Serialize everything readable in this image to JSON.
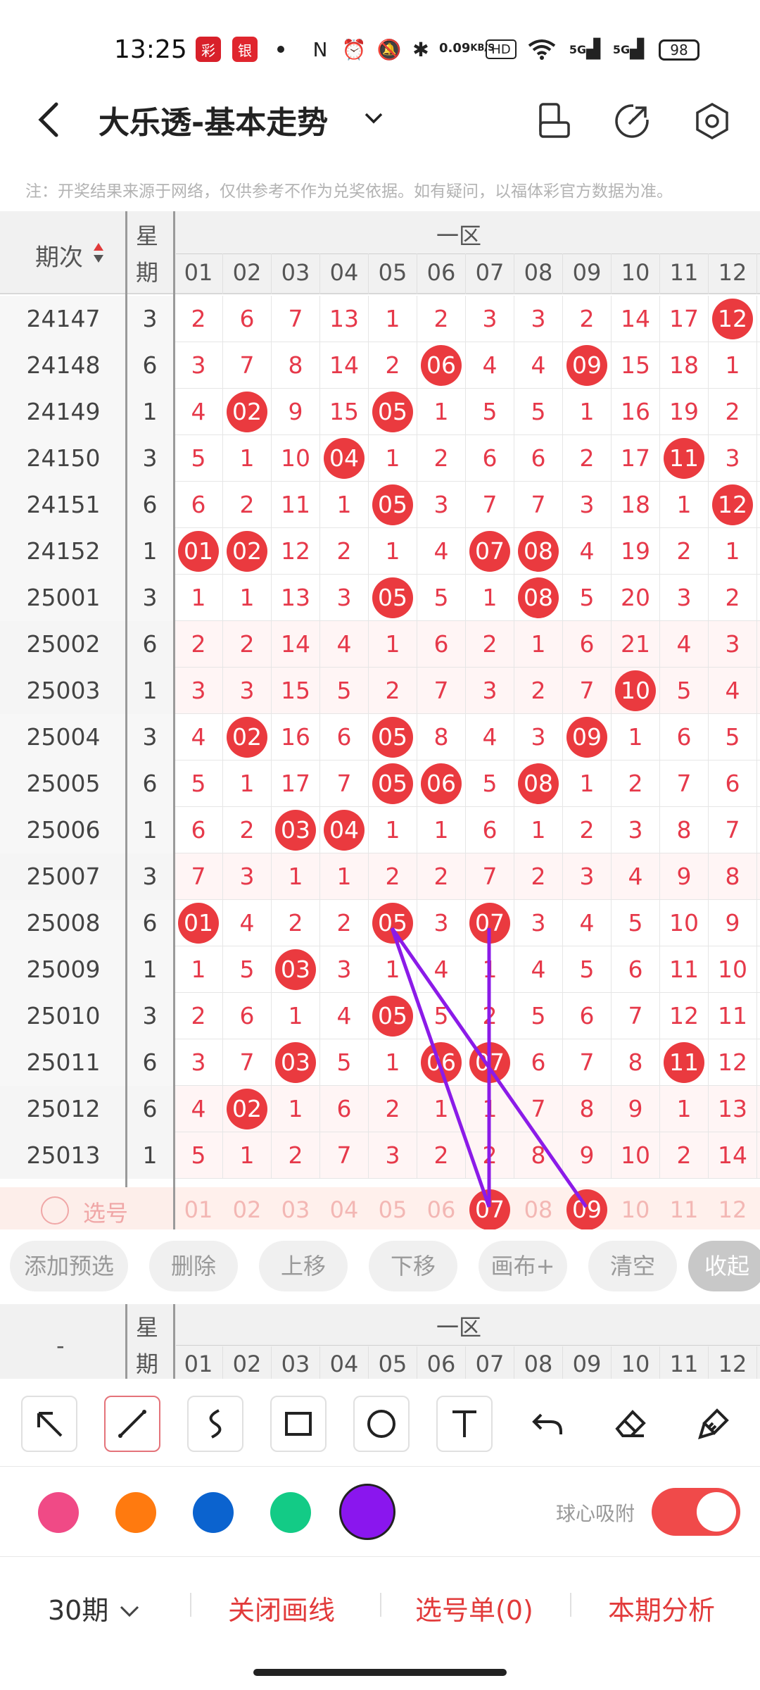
{
  "status": {
    "time": "13:25",
    "net_speed_value": "0.09",
    "net_speed_unit": "KB/S",
    "hd": "HD",
    "signal1": "5G",
    "signal2": "5G",
    "battery": "98"
  },
  "header": {
    "title": "大乐透-基本走势"
  },
  "notice": "注：开奖结果来源于网络，仅供参考不作为兑奖依据。如有疑问，以福体彩官方数据为准。",
  "table": {
    "issue_label": "期次",
    "week_label1": "星",
    "week_label2": "期",
    "zone_label": "一区",
    "columns": [
      "01",
      "02",
      "03",
      "04",
      "05",
      "06",
      "07",
      "08",
      "09",
      "10",
      "11",
      "12"
    ],
    "rows": [
      {
        "issue": "24147",
        "week": "3",
        "cells": [
          "2",
          "6",
          "7",
          "13",
          "1",
          "2",
          "3",
          "3",
          "2",
          "14",
          "17",
          "12"
        ],
        "hits": [
          11
        ]
      },
      {
        "issue": "24148",
        "week": "6",
        "cells": [
          "3",
          "7",
          "8",
          "14",
          "2",
          "06",
          "4",
          "4",
          "09",
          "15",
          "18",
          "1"
        ],
        "hits": [
          5,
          8
        ]
      },
      {
        "issue": "24149",
        "week": "1",
        "cells": [
          "4",
          "02",
          "9",
          "15",
          "05",
          "1",
          "5",
          "5",
          "1",
          "16",
          "19",
          "2"
        ],
        "hits": [
          1,
          4
        ]
      },
      {
        "issue": "24150",
        "week": "3",
        "cells": [
          "5",
          "1",
          "10",
          "04",
          "1",
          "2",
          "6",
          "6",
          "2",
          "17",
          "11",
          "3"
        ],
        "hits": [
          3,
          10
        ]
      },
      {
        "issue": "24151",
        "week": "6",
        "cells": [
          "6",
          "2",
          "11",
          "1",
          "05",
          "3",
          "7",
          "7",
          "3",
          "18",
          "1",
          "12"
        ],
        "hits": [
          4,
          11
        ]
      },
      {
        "issue": "24152",
        "week": "1",
        "cells": [
          "01",
          "02",
          "12",
          "2",
          "1",
          "4",
          "07",
          "08",
          "4",
          "19",
          "2",
          "1"
        ],
        "hits": [
          0,
          1,
          6,
          7
        ]
      },
      {
        "issue": "25001",
        "week": "3",
        "cells": [
          "1",
          "1",
          "13",
          "3",
          "05",
          "5",
          "1",
          "08",
          "5",
          "20",
          "3",
          "2"
        ],
        "hits": [
          4,
          7
        ]
      },
      {
        "issue": "25002",
        "week": "6",
        "cells": [
          "2",
          "2",
          "14",
          "4",
          "1",
          "6",
          "2",
          "1",
          "6",
          "21",
          "4",
          "3"
        ],
        "hits": []
      },
      {
        "issue": "25003",
        "week": "1",
        "cells": [
          "3",
          "3",
          "15",
          "5",
          "2",
          "7",
          "3",
          "2",
          "7",
          "10",
          "5",
          "4"
        ],
        "hits": [
          9
        ]
      },
      {
        "issue": "25004",
        "week": "3",
        "cells": [
          "4",
          "02",
          "16",
          "6",
          "05",
          "8",
          "4",
          "3",
          "09",
          "1",
          "6",
          "5"
        ],
        "hits": [
          1,
          4,
          8
        ]
      },
      {
        "issue": "25005",
        "week": "6",
        "cells": [
          "5",
          "1",
          "17",
          "7",
          "05",
          "06",
          "5",
          "08",
          "1",
          "2",
          "7",
          "6"
        ],
        "hits": [
          4,
          5,
          7
        ]
      },
      {
        "issue": "25006",
        "week": "1",
        "cells": [
          "6",
          "2",
          "03",
          "04",
          "1",
          "1",
          "6",
          "1",
          "2",
          "3",
          "8",
          "7"
        ],
        "hits": [
          2,
          3
        ]
      },
      {
        "issue": "25007",
        "week": "3",
        "cells": [
          "7",
          "3",
          "1",
          "1",
          "2",
          "2",
          "7",
          "2",
          "3",
          "4",
          "9",
          "8"
        ],
        "hits": []
      },
      {
        "issue": "25008",
        "week": "6",
        "cells": [
          "01",
          "4",
          "2",
          "2",
          "05",
          "3",
          "07",
          "3",
          "4",
          "5",
          "10",
          "9"
        ],
        "hits": [
          0,
          4,
          6
        ]
      },
      {
        "issue": "25009",
        "week": "1",
        "cells": [
          "1",
          "5",
          "03",
          "3",
          "1",
          "4",
          "1",
          "4",
          "5",
          "6",
          "11",
          "10"
        ],
        "hits": [
          2
        ]
      },
      {
        "issue": "25010",
        "week": "3",
        "cells": [
          "2",
          "6",
          "1",
          "4",
          "05",
          "5",
          "2",
          "5",
          "6",
          "7",
          "12",
          "11"
        ],
        "hits": [
          4
        ]
      },
      {
        "issue": "25011",
        "week": "6",
        "cells": [
          "3",
          "7",
          "03",
          "5",
          "1",
          "06",
          "07",
          "6",
          "7",
          "8",
          "11",
          "12"
        ],
        "hits": [
          2,
          5,
          6,
          10
        ]
      },
      {
        "issue": "25012",
        "week": "6",
        "cells": [
          "4",
          "02",
          "1",
          "6",
          "2",
          "1",
          "1",
          "7",
          "8",
          "9",
          "1",
          "13"
        ],
        "hits": [
          1
        ]
      },
      {
        "issue": "25013",
        "week": "1",
        "cells": [
          "5",
          "1",
          "2",
          "7",
          "3",
          "2",
          "2",
          "8",
          "9",
          "10",
          "2",
          "14"
        ],
        "hits": []
      }
    ],
    "select_label": "选号",
    "selected_balls": [
      6,
      8
    ]
  },
  "actions": [
    "添加预选",
    "删除",
    "上移",
    "下移",
    "画布+",
    "清空",
    "收起"
  ],
  "second_header": {
    "dash": "-",
    "week1": "星",
    "week2": "期",
    "zone": "一区"
  },
  "tools": [
    "arrow-tool",
    "line-tool",
    "curve-tool",
    "rectangle-tool",
    "circle-tool",
    "text-tool",
    "undo-tool",
    "eraser-tool",
    "clear-brush-tool"
  ],
  "colors": {
    "pink": "#f04a86",
    "orange": "#ff7a0f",
    "blue": "#0b63cf",
    "green": "#13cb86",
    "purple": "#8a16ee",
    "accent": "#ea3a3f"
  },
  "snap": {
    "label": "球心吸附",
    "enabled": true
  },
  "bottom_bar": {
    "periods": "30期",
    "close_lines": "关闭画线",
    "selection_list": "选号单(0)",
    "analysis": "本期分析"
  }
}
